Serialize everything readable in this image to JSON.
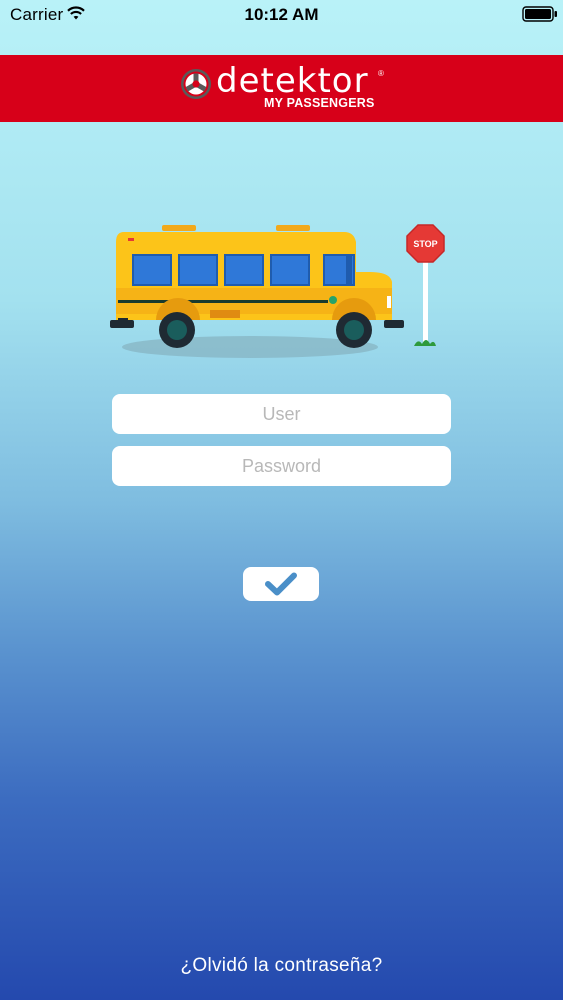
{
  "status_bar": {
    "carrier": "Carrier",
    "time": "10:12 AM",
    "icons": [
      "wifi-icon",
      "battery-icon"
    ]
  },
  "header": {
    "brand_name": "detektor",
    "brand_mark": "®",
    "brand_subtitle": "MY PASSENGERS",
    "background_color": "#d70019"
  },
  "illustration": {
    "stop_sign_text": "STOP"
  },
  "login_form": {
    "user_placeholder": "User",
    "password_placeholder": "Password",
    "submit_icon": "checkmark-icon"
  },
  "footer": {
    "forgot_password": "¿Olvidó la contraseña?"
  }
}
